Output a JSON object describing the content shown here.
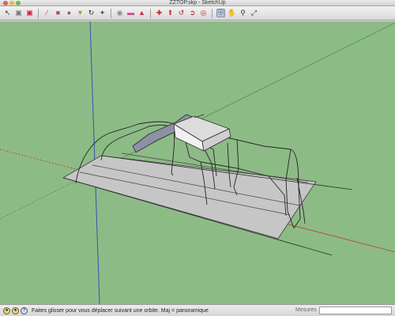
{
  "window": {
    "title": "ZZTOP.skp - SketchUp"
  },
  "toolbar": {
    "icons": [
      "select-arrow",
      "camera-gray",
      "camera-red",
      "separator",
      "pencil",
      "rectangle",
      "circle",
      "push-pull",
      "rotate-orbit",
      "paint-pencil",
      "separator",
      "tape-measure",
      "eraser",
      "paint-bucket",
      "separator",
      "move",
      "pushpull",
      "rotate",
      "follow-me",
      "offset",
      "separator",
      "orbit",
      "pan",
      "zoom",
      "zoom-extents"
    ]
  },
  "status": {
    "text": "Faites glisser pour vous déplacer suivant une orbite.  Maj = panoramique",
    "measures_label": "Mesures",
    "measures_value": ""
  }
}
